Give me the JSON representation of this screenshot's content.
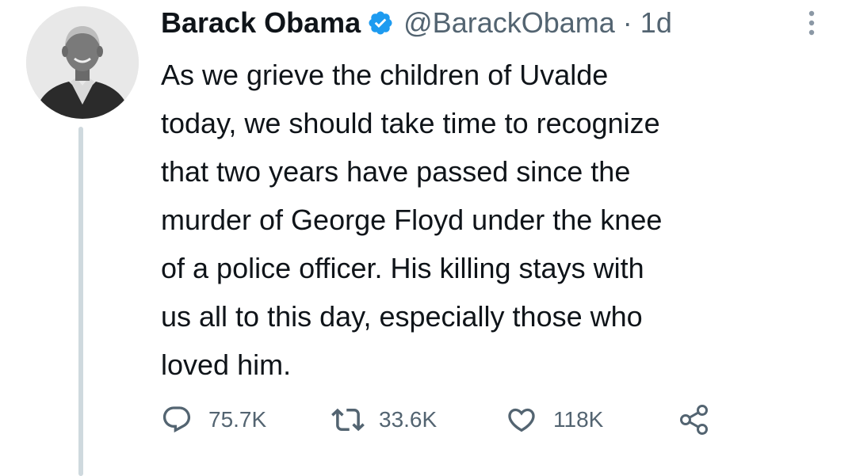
{
  "tweet": {
    "author_name": "Barack Obama",
    "handle": "@BarackObama",
    "separator": "·",
    "time": "1d",
    "verified": true,
    "text": "As we grieve the children of Uvalde\ntoday, we should take time to recognize\nthat two years have passed since the\nmurder of George Floyd under the knee\nof a police officer. His killing stays with\nus all to this day, especially those who\nloved him."
  },
  "actions": {
    "replies": "75.7K",
    "retweets": "33.6K",
    "likes": "118K"
  },
  "icons": {
    "verified": "verified-badge-icon",
    "more": "more-vertical-icon",
    "reply": "reply-bubble-icon",
    "retweet": "retweet-arrows-icon",
    "like": "heart-icon",
    "share": "share-icon"
  },
  "colors": {
    "text": "#0f1419",
    "secondary": "#536471",
    "verified": "#1d9bf0",
    "thread_line": "#cfd9de"
  }
}
